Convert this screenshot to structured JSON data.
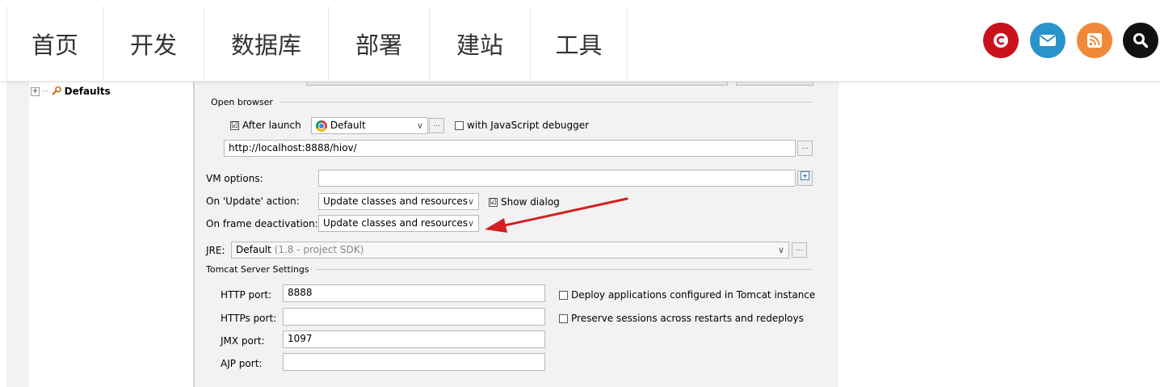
{
  "nav": {
    "items": [
      "首页",
      "开发",
      "数据库",
      "部署",
      "建站",
      "工具"
    ]
  },
  "social": [
    {
      "icon": "csdn-icon",
      "color": "#c9121c"
    },
    {
      "icon": "email-icon",
      "color": "#2a93c9"
    },
    {
      "icon": "rss-icon",
      "color": "#f0883a"
    },
    {
      "icon": "search-icon",
      "color": "#111111"
    }
  ],
  "tree": {
    "node_label": "Defaults"
  },
  "config": {
    "open_browser_label": "Open browser",
    "after_launch_label": "After launch",
    "browser_value": "Default",
    "js_debugger_label": "with JavaScript debugger",
    "url_value": "http://localhost:8888/hiov/",
    "vm_options_label": "VM options:",
    "vm_options_value": "",
    "on_update_label": "On 'Update' action:",
    "on_update_value": "Update classes and resources",
    "show_dialog_label": "Show dialog",
    "on_frame_label": "On frame deactivation:",
    "on_frame_value": "Update classes and resources",
    "jre_label": "JRE:",
    "jre_value": "Default",
    "jre_hint": "(1.8 - project SDK)",
    "tomcat_settings_label": "Tomcat Server Settings",
    "http_port_label": "HTTP port:",
    "http_port_value": "8888",
    "https_port_label": "HTTPs port:",
    "https_port_value": "",
    "jmx_port_label": "JMX port:",
    "jmx_port_value": "1097",
    "ajp_port_label": "AJP port:",
    "ajp_port_value": "",
    "deploy_label": "Deploy applications configured in Tomcat instance",
    "preserve_label": "Preserve sessions across restarts and redeploys",
    "ellipsis": "...",
    "after_launch_checked": "☑",
    "show_dialog_checked": "☑"
  },
  "annotation": {
    "arrow_color": "#d42020"
  }
}
